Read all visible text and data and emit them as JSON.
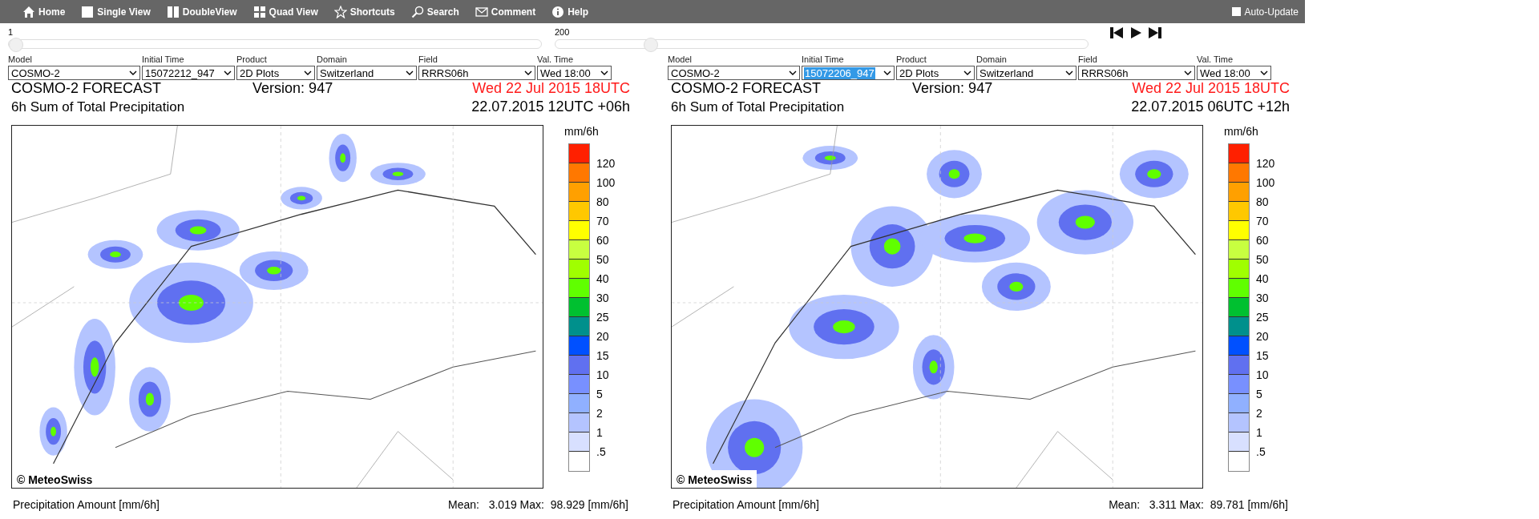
{
  "toolbar": {
    "items": [
      {
        "label": "Home"
      },
      {
        "label": "Single View"
      },
      {
        "label": "DoubleView"
      },
      {
        "label": "Quad View"
      },
      {
        "label": "Shortcuts"
      },
      {
        "label": "Search"
      },
      {
        "label": "Comment"
      },
      {
        "label": "Help"
      }
    ],
    "auto_update": {
      "label": "Auto-Update",
      "checked": false
    }
  },
  "sliders": [
    {
      "label": "1",
      "level": 0
    },
    {
      "label": "200",
      "level": 0.17
    }
  ],
  "panels": [
    {
      "selectors": [
        {
          "label": "Model",
          "value": "COSMO-2",
          "selected": false
        },
        {
          "label": "Initial Time",
          "value": "15072212_947",
          "selected": false
        },
        {
          "label": "Product",
          "value": "2D Plots",
          "selected": false
        },
        {
          "label": "Domain",
          "value": "Switzerland",
          "selected": false
        },
        {
          "label": "Field",
          "value": "RRRS06h",
          "selected": false
        },
        {
          "label": "Val. Time",
          "value": "Wed 18:00",
          "selected": false
        }
      ],
      "title": "COSMO-2 FORECAST",
      "version": "Version: 947",
      "valid_time": "Wed 22 Jul 2015 18UTC",
      "subtitle": "6h Sum of Total Precipitation",
      "run_time": "22.07.2015 12UTC +06h",
      "credit": "© MeteoSwiss",
      "legend": {
        "unit": "mm/6h",
        "ticks": [
          "120",
          "100",
          "80",
          "70",
          "60",
          "50",
          "40",
          "30",
          "25",
          "20",
          "15",
          "10",
          "5",
          "2",
          "1",
          ".5"
        ]
      },
      "footer": "Precipitation Amount [mm/6h]",
      "stats": "Mean:   3.019 Max:  98.929 [mm/6h]"
    },
    {
      "selectors": [
        {
          "label": "Model",
          "value": "COSMO-2",
          "selected": false
        },
        {
          "label": "Initial Time",
          "value": "15072206_947",
          "selected": true
        },
        {
          "label": "Product",
          "value": "2D Plots",
          "selected": false
        },
        {
          "label": "Domain",
          "value": "Switzerland",
          "selected": false
        },
        {
          "label": "Field",
          "value": "RRRS06h",
          "selected": false
        },
        {
          "label": "Val. Time",
          "value": "Wed 18:00",
          "selected": false
        }
      ],
      "title": "COSMO-2 FORECAST",
      "version": "Version: 947",
      "valid_time": "Wed 22 Jul 2015 18UTC",
      "subtitle": "6h Sum of Total Precipitation",
      "run_time": "22.07.2015 06UTC +12h",
      "credit": "© MeteoSwiss",
      "legend": {
        "unit": "mm/6h",
        "ticks": [
          "120",
          "100",
          "80",
          "70",
          "60",
          "50",
          "40",
          "30",
          "25",
          "20",
          "15",
          "10",
          "5",
          "2",
          "1",
          ".5"
        ]
      },
      "footer": "Precipitation Amount [mm/6h]",
      "stats": "Mean:   3.311 Max:  89.781 [mm/6h]"
    }
  ],
  "legend_colors": [
    {
      "color": "#ff2000"
    },
    {
      "color": "#ff7800"
    },
    {
      "color": "#ffa000"
    },
    {
      "color": "#ffc800"
    },
    {
      "color": "#ffff00"
    },
    {
      "color": "#c8ff40"
    },
    {
      "color": "#a0ff00"
    },
    {
      "color": "#60ff00"
    },
    {
      "color": "#00c030"
    },
    {
      "color": "#00908c"
    },
    {
      "color": "#0050ff"
    },
    {
      "color": "#6070f0"
    },
    {
      "color": "#7890ff"
    },
    {
      "color": "#90b0ff"
    },
    {
      "color": "#b4c4ff"
    },
    {
      "color": "#d8e0ff"
    }
  ]
}
